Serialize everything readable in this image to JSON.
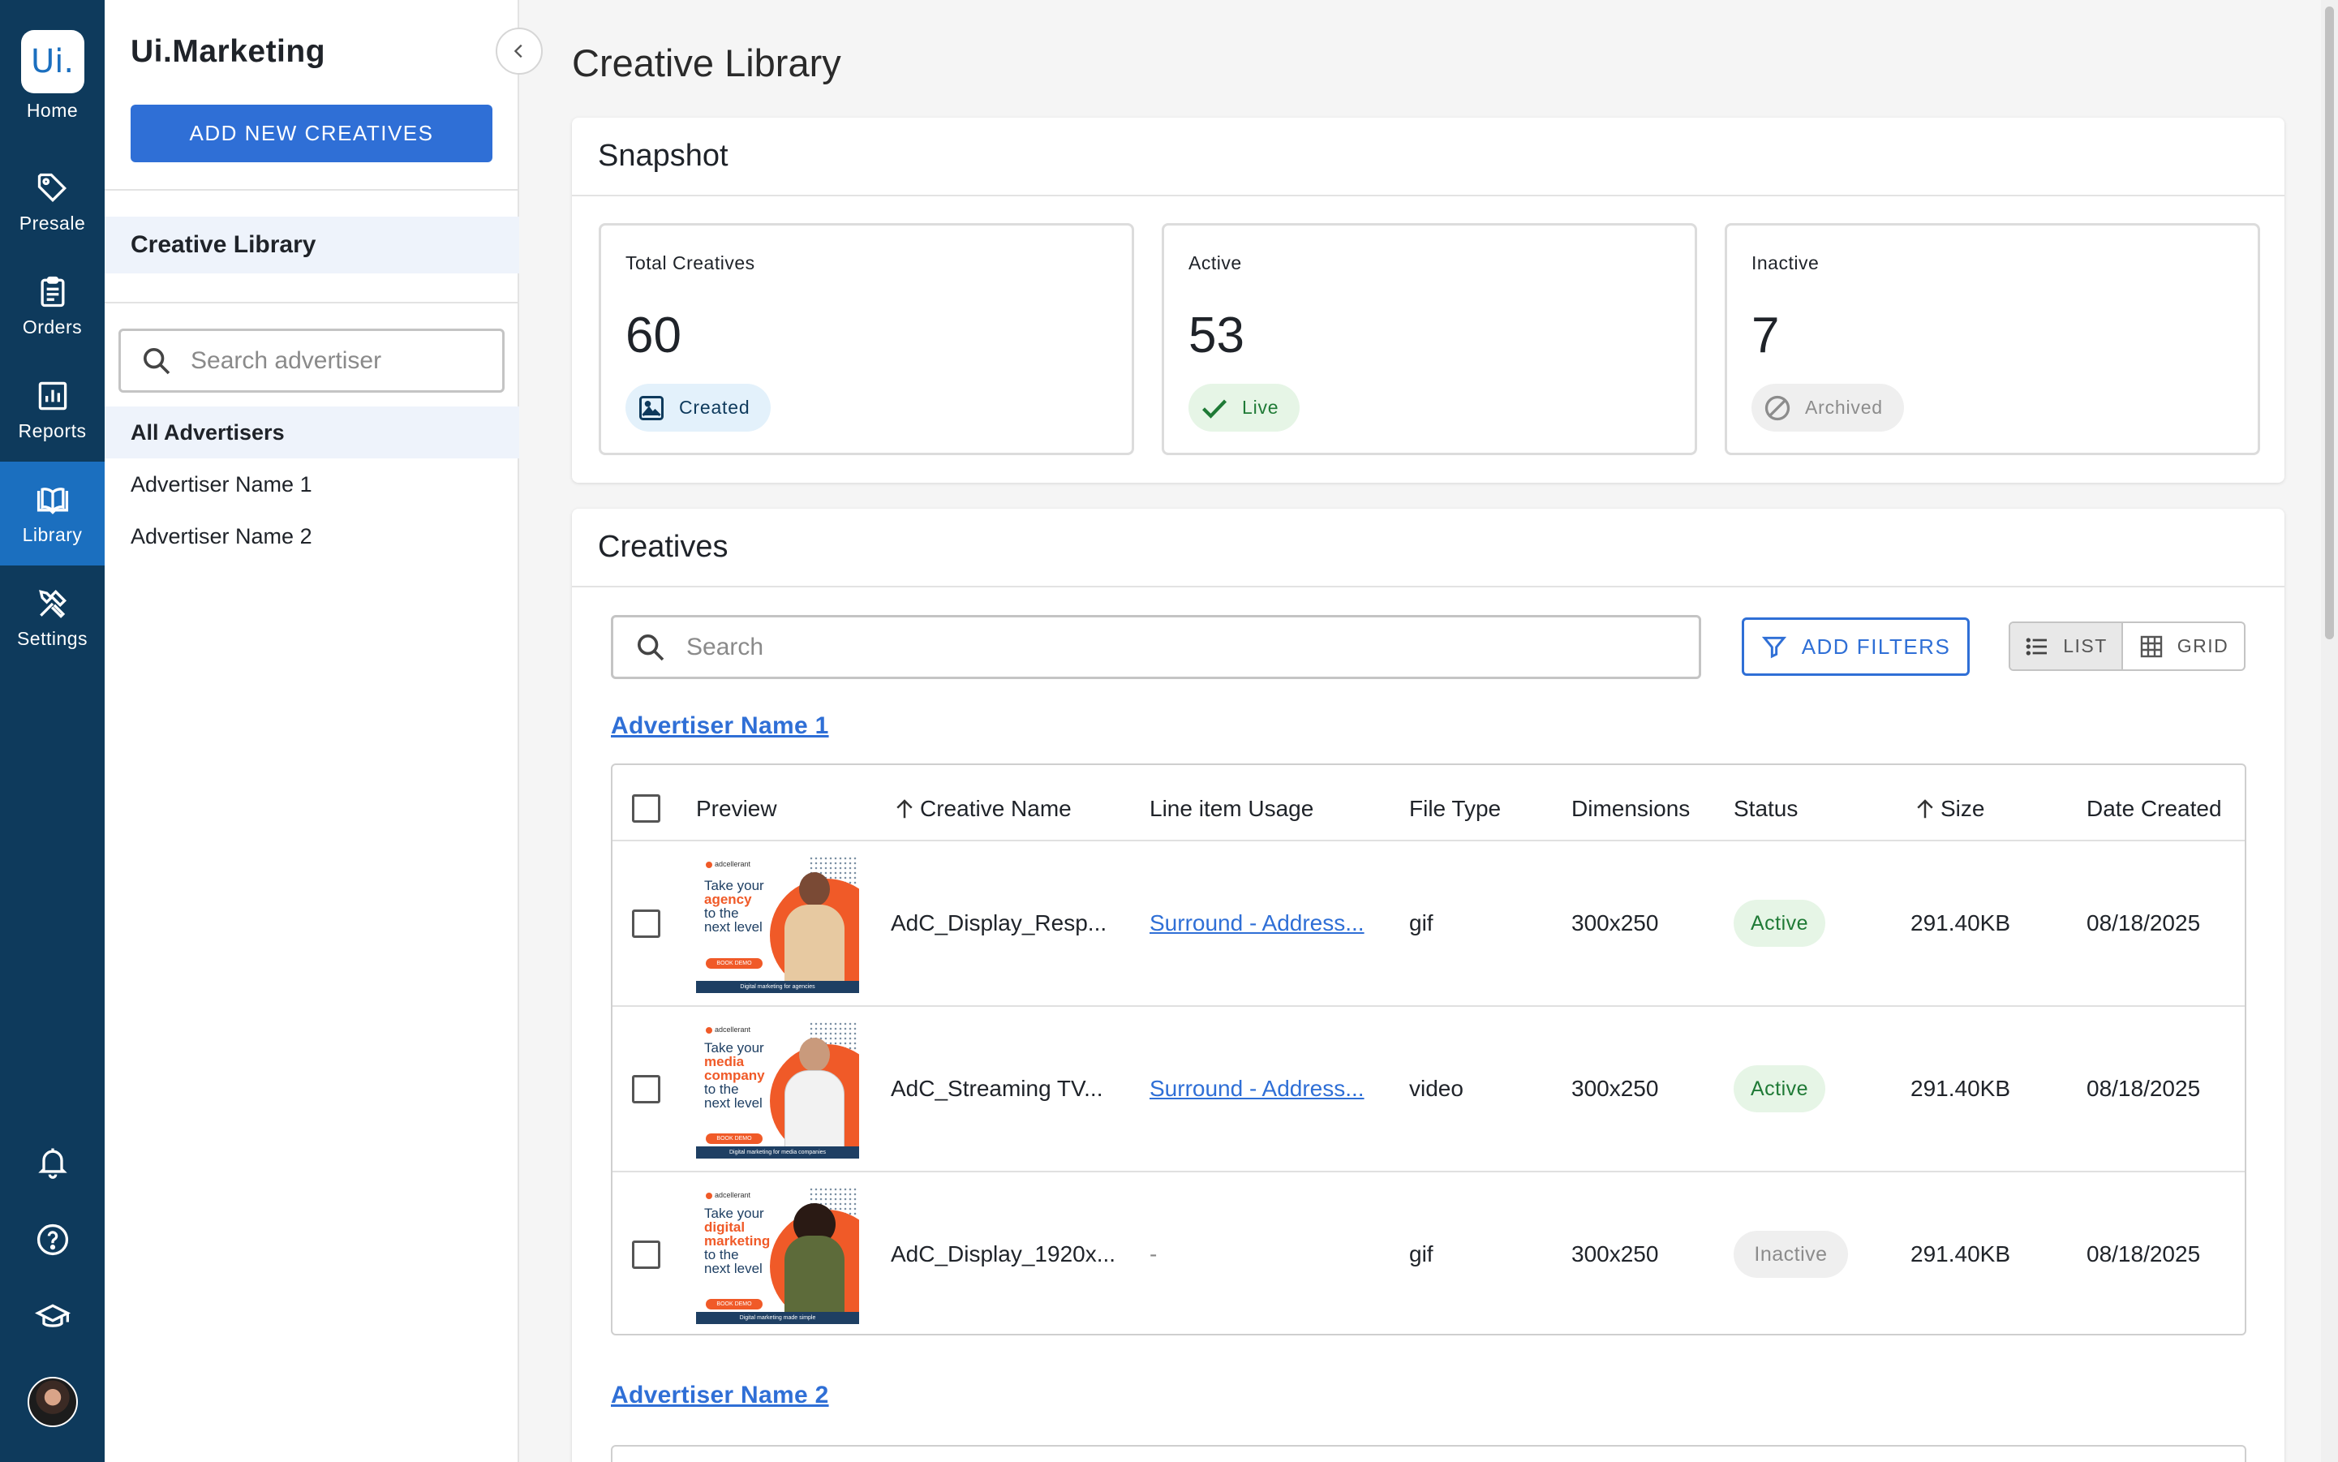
{
  "rail": {
    "logo_text": "Ui.",
    "items": [
      {
        "label": "Home",
        "icon": "home-logo"
      },
      {
        "label": "Presale",
        "icon": "tag-icon"
      },
      {
        "label": "Orders",
        "icon": "clipboard-icon"
      },
      {
        "label": "Reports",
        "icon": "bar-chart-icon"
      },
      {
        "label": "Library",
        "icon": "book-icon",
        "active": true
      },
      {
        "label": "Settings",
        "icon": "tools-icon"
      }
    ],
    "bottom_icons": [
      "bell-icon",
      "help-icon",
      "graduation-cap-icon",
      "avatar"
    ],
    "bg_color": "#0e3a5c",
    "active_color": "#1b6fbf"
  },
  "panel": {
    "title": "Ui.Marketing",
    "add_button": "ADD NEW CREATIVES",
    "section": "Creative Library",
    "search_placeholder": "Search advertiser",
    "advertisers": [
      "All Advertisers",
      "Advertiser Name 1",
      "Advertiser Name 2"
    ]
  },
  "main": {
    "page_title": "Creative Library",
    "snapshot": {
      "title": "Snapshot",
      "stats": [
        {
          "label": "Total Creatives",
          "value": "60",
          "chip": "Created"
        },
        {
          "label": "Active",
          "value": "53",
          "chip": "Live"
        },
        {
          "label": "Inactive",
          "value": "7",
          "chip": "Archived"
        }
      ]
    },
    "creatives": {
      "title": "Creatives",
      "search_placeholder": "Search",
      "filter_button": "ADD FILTERS",
      "view_list": "LIST",
      "view_grid": "GRID",
      "groups": [
        {
          "advertiser": "Advertiser Name 1"
        },
        {
          "advertiser": "Advertiser Name 2"
        }
      ],
      "columns": [
        "Preview",
        "Creative Name",
        "Line item Usage",
        "File Type",
        "Dimensions",
        "Status",
        "Size",
        "Date Created"
      ],
      "rows": [
        {
          "name": "AdC_Display_Resp...",
          "usage": "Surround - Address...",
          "file_type": "gif",
          "dimensions": "300x250",
          "status": "Active",
          "size": "291.40KB",
          "date": "08/18/2025",
          "preview": {
            "brand": "adcellerant",
            "line1": "Take your",
            "hl": "agency",
            "line3": "to the",
            "line4": "next level",
            "cta": "BOOK DEMO",
            "footer": "Digital marketing for agencies"
          }
        },
        {
          "name": "AdC_Streaming TV...",
          "usage": "Surround - Address...",
          "file_type": "video",
          "dimensions": "300x250",
          "status": "Active",
          "size": "291.40KB",
          "date": "08/18/2025",
          "preview": {
            "brand": "adcellerant",
            "line1": "Take your",
            "hl": "media company",
            "line3": "to the",
            "line4": "next level",
            "cta": "BOOK DEMO",
            "footer": "Digital marketing for media companies"
          }
        },
        {
          "name": "AdC_Display_1920x...",
          "usage": "-",
          "file_type": "gif",
          "dimensions": "300x250",
          "status": "Inactive",
          "size": "291.40KB",
          "date": "08/18/2025",
          "preview": {
            "brand": "adcellerant",
            "line1": "Take your",
            "hl": "digital marketing",
            "line3": "to the",
            "line4": "next level",
            "cta": "BOOK DEMO",
            "footer": "Digital marketing made simple"
          }
        }
      ]
    }
  }
}
